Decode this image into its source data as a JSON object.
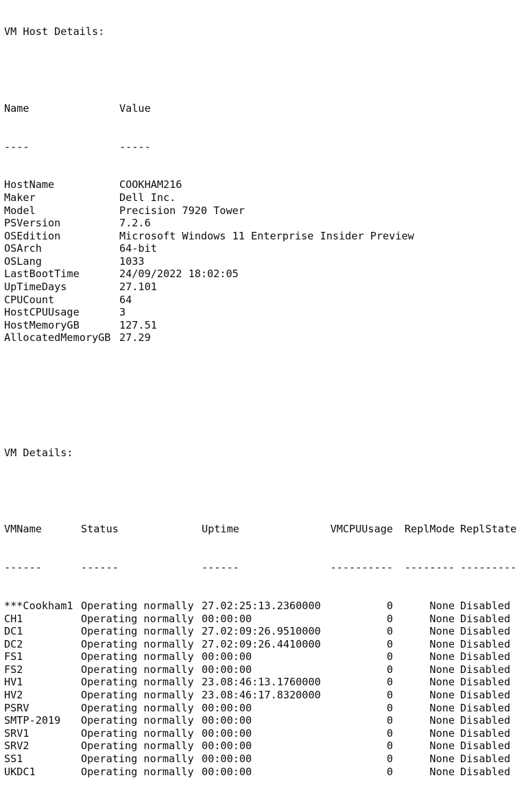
{
  "host_section": {
    "title": "VM Host Details:",
    "headers": {
      "name": "Name",
      "value": "Value"
    },
    "separators": {
      "name": "----",
      "value": "-----"
    },
    "rows": [
      {
        "name": "HostName",
        "value": "COOKHAM216"
      },
      {
        "name": "Maker",
        "value": "Dell Inc."
      },
      {
        "name": "Model",
        "value": "Precision 7920 Tower"
      },
      {
        "name": "PSVersion",
        "value": "7.2.6"
      },
      {
        "name": "OSEdition",
        "value": "Microsoft Windows 11 Enterprise Insider Preview"
      },
      {
        "name": "OSArch",
        "value": "64-bit"
      },
      {
        "name": "OSLang",
        "value": "1033"
      },
      {
        "name": "LastBootTime",
        "value": "24/09/2022 18:02:05"
      },
      {
        "name": "UpTimeDays",
        "value": "27.101"
      },
      {
        "name": "CPUCount",
        "value": "64"
      },
      {
        "name": "HostCPUUsage",
        "value": "3"
      },
      {
        "name": "HostMemoryGB",
        "value": "127.51"
      },
      {
        "name": "AllocatedMemoryGB",
        "value": "27.29"
      }
    ]
  },
  "vm_section": {
    "title": "VM Details:",
    "headers": {
      "vmname": "VMName",
      "status": "Status",
      "uptime": "Uptime",
      "cpu": "VMCPUUsage",
      "replmode": "ReplMode",
      "replstate": "ReplState"
    },
    "separators": {
      "vmname": "------",
      "status": "------",
      "uptime": "------",
      "cpu": "----------",
      "replmode": "--------",
      "replstate": "---------"
    },
    "rows": [
      {
        "vmname": "***Cookham1",
        "status": "Operating normally",
        "uptime": "27.02:25:13.2360000",
        "cpu": "0",
        "replmode": "None",
        "replstate": "Disabled"
      },
      {
        "vmname": "CH1",
        "status": "Operating normally",
        "uptime": "00:00:00",
        "cpu": "0",
        "replmode": "None",
        "replstate": "Disabled"
      },
      {
        "vmname": "DC1",
        "status": "Operating normally",
        "uptime": "27.02:09:26.9510000",
        "cpu": "0",
        "replmode": "None",
        "replstate": "Disabled"
      },
      {
        "vmname": "DC2",
        "status": "Operating normally",
        "uptime": "27.02:09:26.4410000",
        "cpu": "0",
        "replmode": "None",
        "replstate": "Disabled"
      },
      {
        "vmname": "FS1",
        "status": "Operating normally",
        "uptime": "00:00:00",
        "cpu": "0",
        "replmode": "None",
        "replstate": "Disabled"
      },
      {
        "vmname": "FS2",
        "status": "Operating normally",
        "uptime": "00:00:00",
        "cpu": "0",
        "replmode": "None",
        "replstate": "Disabled"
      },
      {
        "vmname": "HV1",
        "status": "Operating normally",
        "uptime": "23.08:46:13.1760000",
        "cpu": "0",
        "replmode": "None",
        "replstate": "Disabled"
      },
      {
        "vmname": "HV2",
        "status": "Operating normally",
        "uptime": "23.08:46:17.8320000",
        "cpu": "0",
        "replmode": "None",
        "replstate": "Disabled"
      },
      {
        "vmname": "PSRV",
        "status": "Operating normally",
        "uptime": "00:00:00",
        "cpu": "0",
        "replmode": "None",
        "replstate": "Disabled"
      },
      {
        "vmname": "SMTP-2019",
        "status": "Operating normally",
        "uptime": "00:00:00",
        "cpu": "0",
        "replmode": "None",
        "replstate": "Disabled"
      },
      {
        "vmname": "SRV1",
        "status": "Operating normally",
        "uptime": "00:00:00",
        "cpu": "0",
        "replmode": "None",
        "replstate": "Disabled"
      },
      {
        "vmname": "SRV2",
        "status": "Operating normally",
        "uptime": "00:00:00",
        "cpu": "0",
        "replmode": "None",
        "replstate": "Disabled"
      },
      {
        "vmname": "SS1",
        "status": "Operating normally",
        "uptime": "00:00:00",
        "cpu": "0",
        "replmode": "None",
        "replstate": "Disabled"
      },
      {
        "vmname": "UKDC1",
        "status": "Operating normally",
        "uptime": "00:00:00",
        "cpu": "0",
        "replmode": "None",
        "replstate": "Disabled"
      }
    ]
  }
}
